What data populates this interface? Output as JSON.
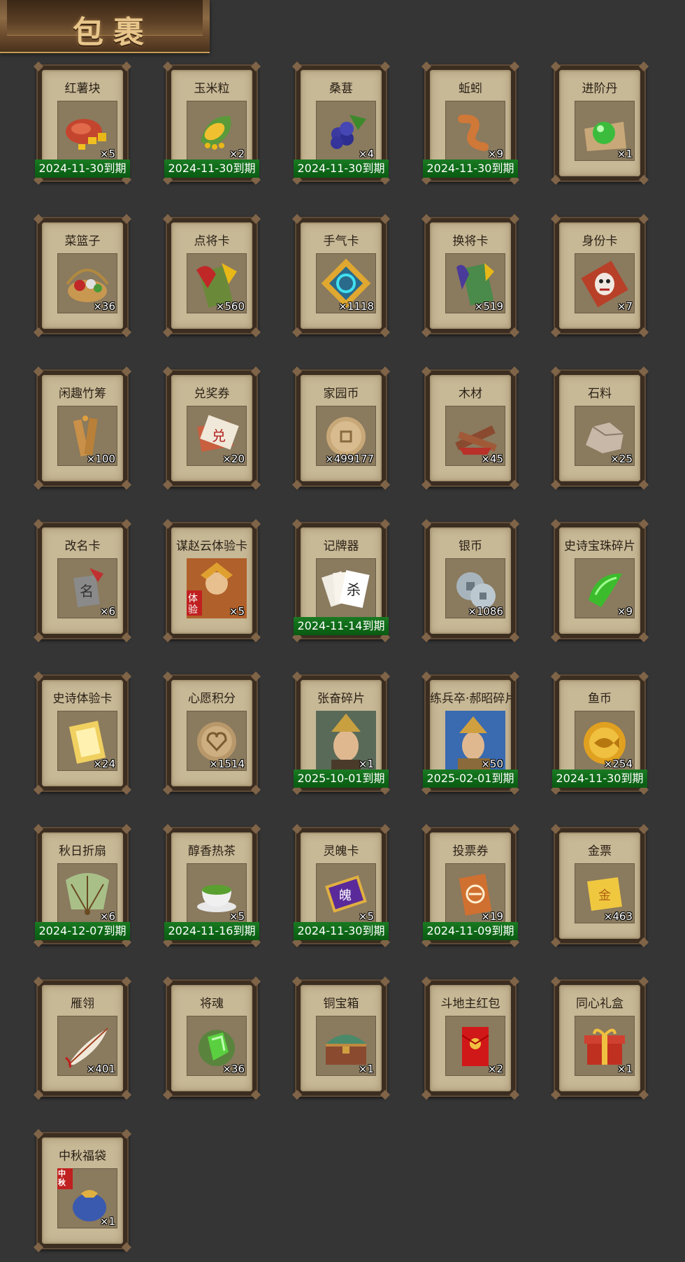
{
  "header": {
    "title": "包裹"
  },
  "items": [
    {
      "name": "红薯块",
      "qty": "×5",
      "expiry": "2024-11-30到期",
      "icon": "sweet-potato-icon"
    },
    {
      "name": "玉米粒",
      "qty": "×2",
      "expiry": "2024-11-30到期",
      "icon": "corn-icon"
    },
    {
      "name": "桑葚",
      "qty": "×4",
      "expiry": "2024-11-30到期",
      "icon": "mulberry-icon"
    },
    {
      "name": "蚯蚓",
      "qty": "×9",
      "expiry": "2024-11-30到期",
      "icon": "earthworm-icon"
    },
    {
      "name": "进阶丹",
      "qty": "×1",
      "expiry": "",
      "icon": "advance-pill-icon"
    },
    {
      "name": "菜篮子",
      "qty": "×36",
      "expiry": "",
      "icon": "basket-icon"
    },
    {
      "name": "点将卡",
      "qty": "×560",
      "expiry": "",
      "icon": "general-card-icon"
    },
    {
      "name": "手气卡",
      "qty": "×1118",
      "expiry": "",
      "icon": "luck-card-icon"
    },
    {
      "name": "换将卡",
      "qty": "×519",
      "expiry": "",
      "icon": "swap-general-card-icon"
    },
    {
      "name": "身份卡",
      "qty": "×7",
      "expiry": "",
      "icon": "identity-card-icon"
    },
    {
      "name": "闲趣竹筹",
      "qty": "×100",
      "expiry": "",
      "icon": "bamboo-token-icon"
    },
    {
      "name": "兑奖券",
      "qty": "×20",
      "expiry": "",
      "icon": "prize-ticket-icon"
    },
    {
      "name": "家园币",
      "qty": "×499177",
      "expiry": "",
      "icon": "home-coin-icon"
    },
    {
      "name": "木材",
      "qty": "×45",
      "expiry": "",
      "icon": "wood-icon"
    },
    {
      "name": "石料",
      "qty": "×25",
      "expiry": "",
      "icon": "stone-icon"
    },
    {
      "name": "改名卡",
      "qty": "×6",
      "expiry": "",
      "icon": "rename-card-icon"
    },
    {
      "name": "谋赵云体验卡",
      "qty": "×5",
      "expiry": "",
      "icon": "zhaoyun-trial-card-icon"
    },
    {
      "name": "记牌器",
      "qty": "",
      "expiry": "2024-11-14到期",
      "icon": "card-counter-icon"
    },
    {
      "name": "银币",
      "qty": "×1086",
      "expiry": "",
      "icon": "silver-coin-icon"
    },
    {
      "name": "史诗宝珠碎片",
      "qty": "×9",
      "expiry": "",
      "icon": "epic-orb-shard-icon"
    },
    {
      "name": "史诗体验卡",
      "qty": "×24",
      "expiry": "",
      "icon": "epic-trial-card-icon"
    },
    {
      "name": "心愿积分",
      "qty": "×1514",
      "expiry": "",
      "icon": "wish-points-icon"
    },
    {
      "name": "张奋碎片",
      "qty": "×1",
      "expiry": "2025-10-01到期",
      "icon": "zhangfen-shard-icon"
    },
    {
      "name": "练兵卒·郝昭碎片",
      "qty": "×50",
      "expiry": "2025-02-01到期",
      "icon": "haozhao-shard-icon"
    },
    {
      "name": "鱼币",
      "qty": "×254",
      "expiry": "2024-11-30到期",
      "icon": "fish-coin-icon"
    },
    {
      "name": "秋日折扇",
      "qty": "×6",
      "expiry": "2024-12-07到期",
      "icon": "folding-fan-icon"
    },
    {
      "name": "醇香热茶",
      "qty": "×5",
      "expiry": "2024-11-16到期",
      "icon": "hot-tea-icon"
    },
    {
      "name": "灵魄卡",
      "qty": "×5",
      "expiry": "2024-11-30到期",
      "icon": "soul-card-icon"
    },
    {
      "name": "投票券",
      "qty": "×19",
      "expiry": "2024-11-09到期",
      "icon": "vote-ticket-icon"
    },
    {
      "name": "金票",
      "qty": "×463",
      "expiry": "",
      "icon": "gold-ticket-icon"
    },
    {
      "name": "雁翎",
      "qty": "×401",
      "expiry": "",
      "icon": "goose-feather-icon"
    },
    {
      "name": "将魂",
      "qty": "×36",
      "expiry": "",
      "icon": "general-soul-icon"
    },
    {
      "name": "铜宝箱",
      "qty": "×1",
      "expiry": "",
      "icon": "bronze-chest-icon"
    },
    {
      "name": "斗地主红包",
      "qty": "×2",
      "expiry": "",
      "icon": "red-envelope-icon"
    },
    {
      "name": "同心礼盒",
      "qty": "×1",
      "expiry": "",
      "icon": "gift-box-icon"
    },
    {
      "name": "中秋福袋",
      "qty": "×1",
      "expiry": "",
      "icon": "lucky-bag-icon",
      "badge": "中秋"
    }
  ]
}
